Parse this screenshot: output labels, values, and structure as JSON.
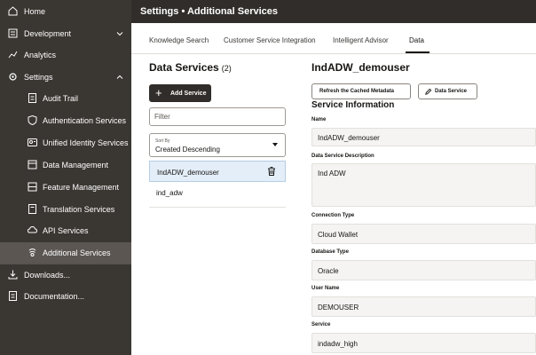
{
  "sidebar": {
    "items": [
      {
        "label": "Home",
        "icon": "home-icon"
      },
      {
        "label": "Development",
        "icon": "development-icon"
      },
      {
        "label": "Analytics",
        "icon": "analytics-icon"
      },
      {
        "label": "Settings",
        "icon": "settings-icon"
      },
      {
        "label": "Downloads...",
        "icon": "download-icon"
      },
      {
        "label": "Documentation...",
        "icon": "documentation-icon"
      }
    ],
    "settings_items": [
      {
        "label": "Audit Trail",
        "icon": "audit-trail-icon"
      },
      {
        "label": "Authentication Services",
        "icon": "shield-icon"
      },
      {
        "label": "Unified Identity Services",
        "icon": "identity-icon"
      },
      {
        "label": "Data Management",
        "icon": "data-management-icon"
      },
      {
        "label": "Feature Management",
        "icon": "feature-management-icon"
      },
      {
        "label": "Translation Services",
        "icon": "translation-icon"
      },
      {
        "label": "API Services",
        "icon": "api-icon"
      },
      {
        "label": "Additional Services",
        "icon": "additional-services-icon"
      }
    ]
  },
  "header": {
    "title": "Settings • Additional Services"
  },
  "tabs": [
    {
      "label": "Knowledge Search"
    },
    {
      "label": "Customer Service Integration"
    },
    {
      "label": "Intelligent Advisor"
    },
    {
      "label": "Data"
    }
  ],
  "data_services": {
    "title": "Data Services",
    "count": "(2)",
    "add_button": "Add Service",
    "filter_placeholder": "Filter",
    "sort_label": "Sort By",
    "sort_value": "Created Descending",
    "items": [
      {
        "name": "IndADW_demouser"
      },
      {
        "name": "ind_adw"
      }
    ]
  },
  "detail": {
    "title": "IndADW_demouser",
    "refresh_button": "Refresh the Cached Metadata",
    "edit_button": "Data Service",
    "section_title": "Service Information",
    "fields": [
      {
        "label": "Name",
        "value": "IndADW_demouser"
      },
      {
        "label": "Data Service Description",
        "value": "Ind ADW"
      },
      {
        "label": "Connection Type",
        "value": "Cloud Wallet"
      },
      {
        "label": "Database Type",
        "value": "Oracle"
      },
      {
        "label": "User Name",
        "value": "DEMOUSER"
      },
      {
        "label": "Service",
        "value": "indadw_high"
      }
    ]
  },
  "colors": {
    "sidebar_bg": "#3a3632",
    "sidebar_active": "#5b5652",
    "header_bg": "#312d2a",
    "selected_row": "#e4eef8",
    "field_bg": "#f5f4f2"
  }
}
